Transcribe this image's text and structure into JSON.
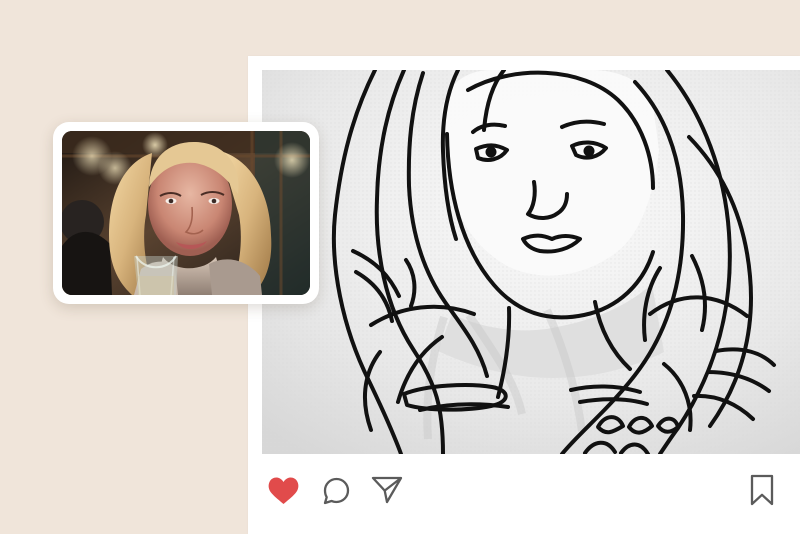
{
  "page": {
    "background_color": "#f0e5da"
  },
  "post": {
    "main_image": {
      "description_icon": "line-art-portrait-image"
    },
    "actions": {
      "like_icon": "heart-icon",
      "comment_icon": "comment-icon",
      "share_icon": "send-icon",
      "save_icon": "bookmark-icon",
      "like_color": "#e14b4b",
      "icon_color": "#5b5b5b"
    }
  },
  "reference_photo": {
    "icon": "portrait-photo-thumbnail",
    "border_color": "#ffffff"
  }
}
